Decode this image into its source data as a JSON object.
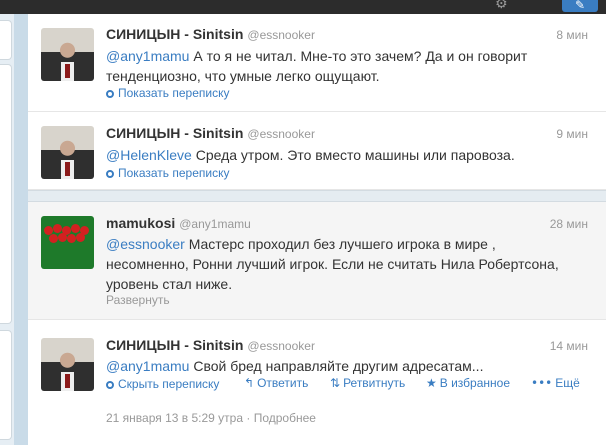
{
  "tweets": [
    {
      "author": "СИНИЦЫН - Sinitsin",
      "handle": "@essnooker",
      "time": "8 мин",
      "mention": "@any1mamu",
      "text": " А то я не читал. Мне-то это зачем? Да и он говорит тенденциозно, что умные легко ощущают.",
      "action": "Показать переписку"
    },
    {
      "author": "СИНИЦЫН - Sinitsin",
      "handle": "@essnooker",
      "time": "9 мин",
      "mention": "@HelenKleve",
      "text": " Среда утром. Это вместо машины или паровоза.",
      "action": "Показать переписку"
    },
    {
      "author": "mamukosi",
      "handle": "@any1mamu",
      "time": "28 мин",
      "mention": "@essnooker",
      "text": " Мастерс проходил без лучшего игрока в мире , несомненно, Ронни лучший игрок. Если не считать Нила Робертсона, уровень стал ниже.",
      "action": "Развернуть"
    },
    {
      "author": "СИНИЦЫН - Sinitsin",
      "handle": "@essnooker",
      "time": "14 мин",
      "mention": "@any1mamu",
      "text": " Свой бред направляйте другим адресатам...",
      "actions": {
        "hide": "Скрыть переписку",
        "reply": "Ответить",
        "retweet": "Ретвитнуть",
        "favorite": "В избранное",
        "more": "Ещё"
      },
      "date": "21 января 13 в 5:29 утра",
      "details_sep": " · ",
      "details": "Подробнее"
    }
  ],
  "icons": {
    "conversation": "conversation-icon",
    "reply": "reply-icon",
    "retweet": "retweet-icon",
    "favorite": "star-icon",
    "more": "more-icon",
    "settings": "gear-icon",
    "compose": "compose-icon"
  },
  "colors": {
    "link": "#3a7dc2",
    "muted": "#999999",
    "text": "#333333",
    "background": "#c9dbe8"
  }
}
